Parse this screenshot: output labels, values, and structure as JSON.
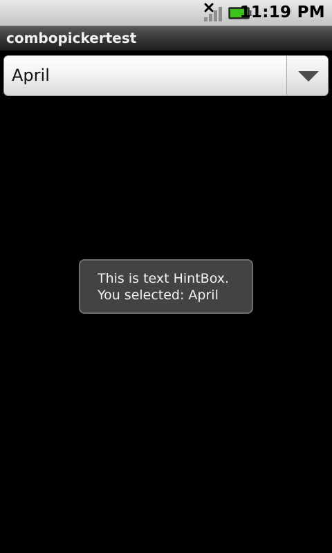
{
  "status_bar": {
    "time": "11:19 PM",
    "icons": [
      "signal-no-service-icon",
      "battery-icon"
    ],
    "battery_color": "#3cc41b"
  },
  "app": {
    "title": "combopickertest"
  },
  "spinner": {
    "selected_value": "April",
    "arrow_icon": "chevron-down-icon"
  },
  "toast": {
    "line1": "This is text HintBox.",
    "line2": "You selected: April"
  }
}
